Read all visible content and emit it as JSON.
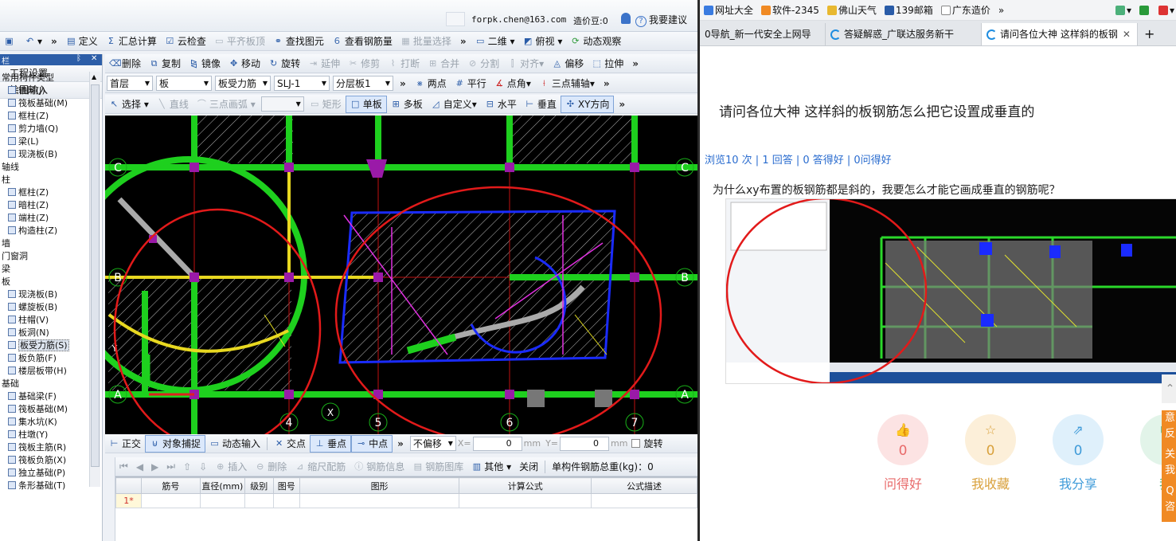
{
  "cad": {
    "titlebar": {
      "user": "forpk.chen@163.com",
      "bean_label": "造价豆:0",
      "suggest": "我要建议"
    },
    "toolbar1": {
      "define": "定义",
      "summary": "汇总计算",
      "cloud_check": "云检查",
      "flush_slab": "平齐板顶",
      "find_element": "查找图元",
      "view_rebar": "查看钢筋量",
      "batch_select": "批量选择",
      "view_2d": "二维",
      "top_view": "俯视",
      "dynamic_view": "动态观察"
    },
    "toolbar2": {
      "delete": "删除",
      "copy": "复制",
      "mirror": "镜像",
      "move": "移动",
      "rotate": "旋转",
      "extend": "延伸",
      "trim": "修剪",
      "break": "打断",
      "merge": "合并",
      "split": "分割",
      "align": "对齐",
      "offset": "偏移",
      "stretch": "拉伸"
    },
    "toolbar3": {
      "floor": "首层",
      "category": "板",
      "element_type": "板受力筋",
      "element_name": "SLJ-1",
      "layer": "分层板1",
      "two_point": "两点",
      "parallel": "平行",
      "point_angle": "点角",
      "three_point_axis": "三点辅轴"
    },
    "toolbar4": {
      "select": "选择",
      "line": "直线",
      "arc3": "三点画弧",
      "rect": "矩形",
      "single_slab": "单板",
      "multi_slab": "多板",
      "custom": "自定义",
      "horizontal": "水平",
      "vertical": "垂直",
      "xy_direction": "XY方向"
    },
    "left_panel": {
      "project_settings": "工程设置",
      "drawing_input": "绘图输入",
      "tree": [
        {
          "label": "常用构件类型",
          "child": false
        },
        {
          "label": "轴网(J)",
          "child": true
        },
        {
          "label": "筏板基础(M)",
          "child": true
        },
        {
          "label": "框柱(Z)",
          "child": true
        },
        {
          "label": "剪力墙(Q)",
          "child": true
        },
        {
          "label": "梁(L)",
          "child": true
        },
        {
          "label": "现浇板(B)",
          "child": true
        },
        {
          "label": "轴线",
          "child": false
        },
        {
          "label": "柱",
          "child": false
        },
        {
          "label": "框柱(Z)",
          "child": true
        },
        {
          "label": "暗柱(Z)",
          "child": true
        },
        {
          "label": "端柱(Z)",
          "child": true
        },
        {
          "label": "构造柱(Z)",
          "child": true
        },
        {
          "label": "墙",
          "child": false
        },
        {
          "label": "门窗洞",
          "child": false
        },
        {
          "label": "梁",
          "child": false
        },
        {
          "label": "板",
          "child": false
        },
        {
          "label": "现浇板(B)",
          "child": true
        },
        {
          "label": "螺旋板(B)",
          "child": true
        },
        {
          "label": "柱帽(V)",
          "child": true
        },
        {
          "label": "板洞(N)",
          "child": true
        },
        {
          "label": "板受力筋(S)",
          "child": true,
          "selected": true
        },
        {
          "label": "板负筋(F)",
          "child": true
        },
        {
          "label": "楼层板带(H)",
          "child": true
        },
        {
          "label": "基础",
          "child": false
        },
        {
          "label": "基础梁(F)",
          "child": true
        },
        {
          "label": "筏板基础(M)",
          "child": true
        },
        {
          "label": "集水坑(K)",
          "child": true
        },
        {
          "label": "柱墩(Y)",
          "child": true
        },
        {
          "label": "筏板主筋(R)",
          "child": true
        },
        {
          "label": "筏板负筋(X)",
          "child": true
        },
        {
          "label": "独立基础(P)",
          "child": true
        },
        {
          "label": "条形基础(T)",
          "child": true
        }
      ]
    },
    "canvas_labels": {
      "axis_C": "C",
      "axis_B": "B",
      "axis_A": "A",
      "axis_4": "4",
      "axis_5": "5",
      "axis_6": "6",
      "axis_7": "7",
      "axis_x": "X",
      "axis_y": "Y"
    },
    "toolbar5": {
      "ortho": "正交",
      "snap": "对象捕捉",
      "dynamic_input": "动态输入",
      "intersection": "交点",
      "perpendicular": "垂点",
      "midpoint": "中点",
      "no_offset": "不偏移",
      "x_label": "X=",
      "x_value": "0",
      "y_label": "Y=",
      "y_value": "0",
      "unit": "mm",
      "rotate": "旋转"
    },
    "toolbar6": {
      "insert": "插入",
      "delete": "删除",
      "scale_bar": "缩尺配筋",
      "rebar_info": "钢筋信息",
      "rebar_lib": "钢筋图库",
      "other": "其他",
      "close": "关闭",
      "total_weight": "单构件钢筋总重(kg)：0"
    },
    "table": {
      "headers": [
        "",
        "筋号",
        "直径(mm)",
        "级别",
        "图号",
        "图形",
        "计算公式",
        "公式描述"
      ],
      "row_index": "1*"
    }
  },
  "browser": {
    "favorites": [
      "网址大全",
      "软件-2345",
      "佛山天气",
      "139邮箱",
      "广东造价"
    ],
    "tabs": [
      {
        "label": "0导航_新一代安全上网导",
        "active": false
      },
      {
        "label": "答疑解惑_广联达服务新干",
        "active": false
      },
      {
        "label": "请问各位大神 这样斜的板钢",
        "active": true
      }
    ],
    "question": {
      "title": "请问各位大神 这样斜的板钢筋怎么把它设置成垂直的",
      "stats": "浏览10 次 | 1 回答 | 0 答得好 | 0问得好",
      "body": "为什么xy布置的板钢筋都是斜的，我要怎么才能它画成垂直的钢筋呢？"
    },
    "actions": [
      {
        "label": "问得好",
        "count": "0",
        "color": "#e86a6a",
        "bg": "#fce3e3"
      },
      {
        "label": "我收藏",
        "count": "0",
        "color": "#d9a13c",
        "bg": "#fcefd9"
      },
      {
        "label": "我分享",
        "count": "0",
        "color": "#3f9bd9",
        "bg": "#dff0fb"
      },
      {
        "label": "我",
        "count": "",
        "color": "#4cb07a",
        "bg": "#e2f4e9"
      }
    ],
    "side_panel": [
      "意",
      "反",
      "关",
      "我",
      "Q",
      "咨"
    ]
  }
}
